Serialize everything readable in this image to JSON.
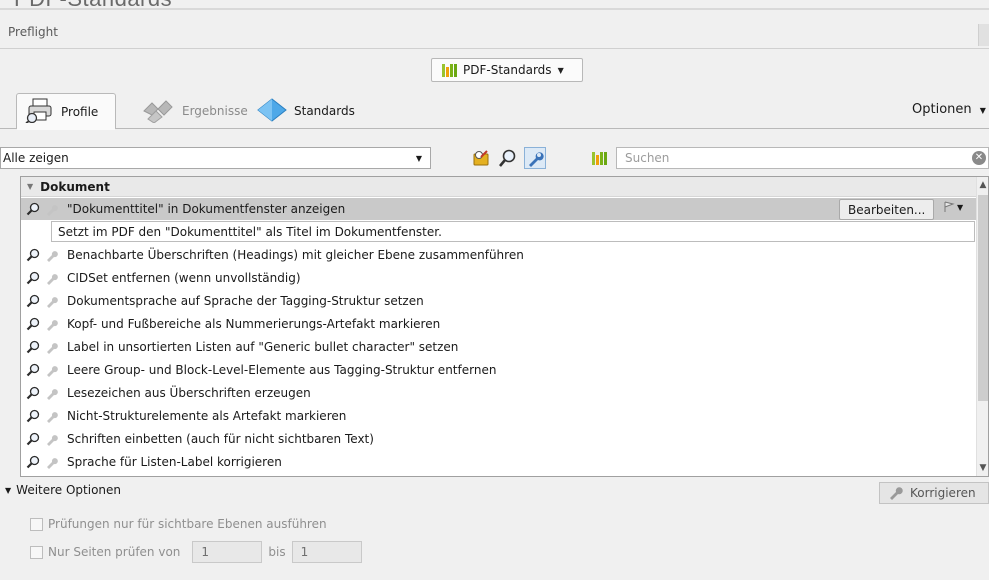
{
  "header": {
    "faded_heading": "PDF-Standards",
    "window_title": "Preflight"
  },
  "standards_dropdown": {
    "label": "PDF-Standards"
  },
  "tabs": [
    {
      "label": "Profile",
      "icon": "profile-printer-icon",
      "active": true
    },
    {
      "label": "Ergebnisse",
      "icon": "results-icon",
      "active": false
    },
    {
      "label": "Standards",
      "icon": "standards-diamond-icon",
      "active": false
    }
  ],
  "options_label": "Optionen",
  "toolbar": {
    "filter_value": "Alle zeigen",
    "search_placeholder": "Suchen"
  },
  "list": {
    "group": "Dokument",
    "selected_item": "\"Dokumenttitel\" in Dokumentfenster anzeigen",
    "selected_description": "Setzt im PDF den \"Dokumenttitel\" als Titel im Dokumentfenster.",
    "edit_button": "Bearbeiten...",
    "items": [
      "Benachbarte Überschriften (Headings) mit gleicher Ebene zusammenführen",
      "CIDSet entfernen (wenn unvollständig)",
      "Dokumentsprache auf Sprache der Tagging-Struktur setzen",
      "Kopf- und Fußbereiche als Nummerierungs-Artefakt markieren",
      "Label in unsortierten Listen auf \"Generic bullet character\" setzen",
      "Leere Group- und Block-Level-Elemente aus Tagging-Struktur entfernen",
      "Lesezeichen aus Überschriften erzeugen",
      "Nicht-Strukturelemente als Artefakt markieren",
      "Schriften einbetten (auch für nicht sichtbaren Text)",
      "Sprache für Listen-Label korrigieren"
    ]
  },
  "bottom": {
    "more_options": "Weitere Optionen",
    "fix_button": "Korrigieren",
    "option1": "Prüfungen nur für sichtbare Ebenen ausführen",
    "option2_label": "Nur Seiten prüfen von",
    "from_value": "1",
    "to_label": "bis",
    "to_value": "1"
  }
}
